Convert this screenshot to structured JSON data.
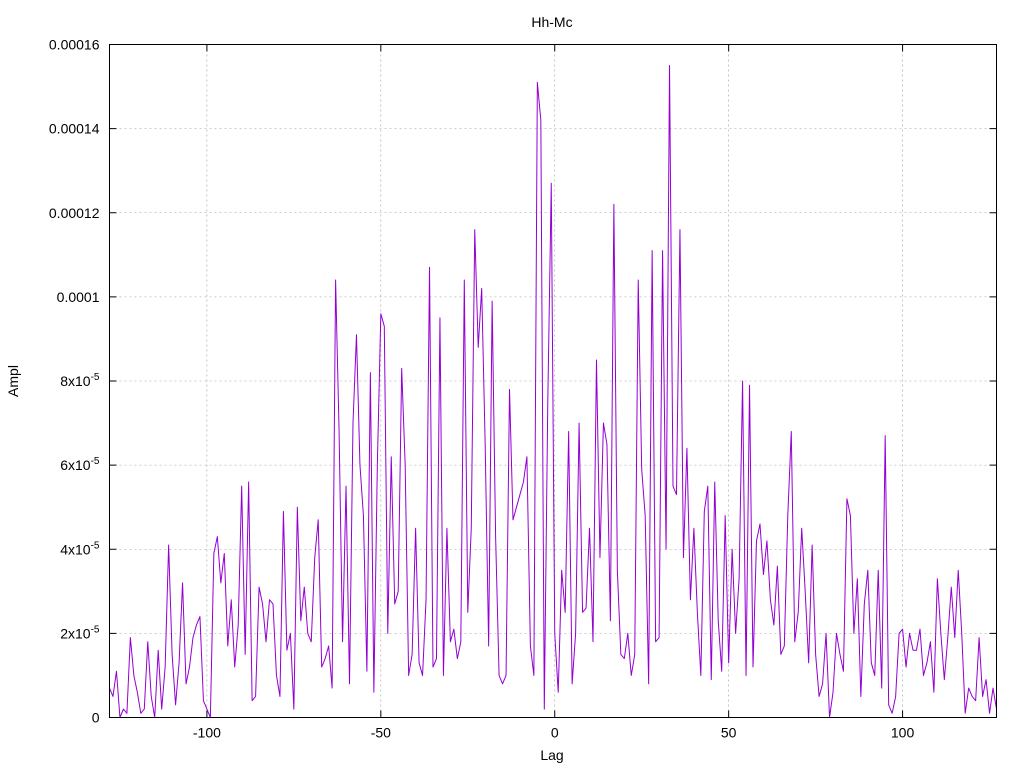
{
  "chart_data": {
    "type": "line",
    "title": "Hh-Mc",
    "xlabel": "Lag",
    "ylabel": "Ampl",
    "xlim": [
      -128,
      127
    ],
    "ylim": [
      0,
      0.00016
    ],
    "grid": true,
    "line_color": "#9400d3",
    "x_ticks": [
      {
        "value": -100,
        "label": "-100"
      },
      {
        "value": -50,
        "label": "-50"
      },
      {
        "value": 0,
        "label": "0"
      },
      {
        "value": 50,
        "label": "50"
      },
      {
        "value": 100,
        "label": "100"
      }
    ],
    "y_ticks": [
      {
        "value": 0,
        "label": "0",
        "mantissa": "0",
        "exponent": ""
      },
      {
        "value": 2e-05,
        "label": "2x10-5",
        "mantissa": "2x10",
        "exponent": "-5"
      },
      {
        "value": 4e-05,
        "label": "4x10-5",
        "mantissa": "4x10",
        "exponent": "-5"
      },
      {
        "value": 6e-05,
        "label": "6x10-5",
        "mantissa": "6x10",
        "exponent": "-5"
      },
      {
        "value": 8e-05,
        "label": "8x10-5",
        "mantissa": "8x10",
        "exponent": "-5"
      },
      {
        "value": 0.0001,
        "label": "0.0001",
        "mantissa": "0.0001",
        "exponent": ""
      },
      {
        "value": 0.00012,
        "label": "0.00012",
        "mantissa": "0.00012",
        "exponent": ""
      },
      {
        "value": 0.00014,
        "label": "0.00014",
        "mantissa": "0.00014",
        "exponent": ""
      },
      {
        "value": 0.00016,
        "label": "0.00016",
        "mantissa": "0.00016",
        "exponent": ""
      }
    ],
    "series": [
      {
        "x_start": -128,
        "x_step": 1,
        "values": [
          7e-06,
          5e-06,
          1.1e-05,
          0.0,
          2e-06,
          1e-06,
          1.9e-05,
          1e-05,
          6e-06,
          1e-06,
          2e-06,
          1.8e-05,
          5e-06,
          0.0,
          1.6e-05,
          2e-06,
          1.2e-05,
          4.1e-05,
          1.5e-05,
          3e-06,
          1.3e-05,
          3.2e-05,
          8e-06,
          1.2e-05,
          1.9e-05,
          2.2e-05,
          2.4e-05,
          4e-06,
          2e-06,
          0.0,
          3.9e-05,
          4.3e-05,
          3.2e-05,
          3.9e-05,
          1.7e-05,
          2.8e-05,
          1.2e-05,
          2.2e-05,
          5.5e-05,
          1.5e-05,
          5.6e-05,
          4e-06,
          5e-06,
          3.1e-05,
          2.7e-05,
          1.8e-05,
          2.8e-05,
          2.7e-05,
          1e-05,
          5e-06,
          4.9e-05,
          1.6e-05,
          2e-05,
          2e-06,
          5e-05,
          2.3e-05,
          3.1e-05,
          2e-05,
          1.8e-05,
          3.8e-05,
          4.7e-05,
          1.2e-05,
          1.4e-05,
          1.7e-05,
          7e-06,
          0.000104,
          6.8e-05,
          1.8e-05,
          5.5e-05,
          8e-06,
          7e-05,
          9.1e-05,
          6e-05,
          4.8e-05,
          1.1e-05,
          8.2e-05,
          6e-06,
          6e-05,
          9.6e-05,
          9.3e-05,
          2e-05,
          6.2e-05,
          2.7e-05,
          3e-05,
          8.3e-05,
          6e-05,
          1e-05,
          1.5e-05,
          4.5e-05,
          1.3e-05,
          1e-05,
          2.8e-05,
          0.000107,
          1.2e-05,
          1.4e-05,
          9.5e-05,
          1e-05,
          4.5e-05,
          1.8e-05,
          2.1e-05,
          1.4e-05,
          1.8e-05,
          0.000104,
          2.5e-05,
          4.5e-05,
          0.000116,
          8.8e-05,
          0.000102,
          6.5e-05,
          1.7e-05,
          9.9e-05,
          4.3e-05,
          1e-05,
          8e-06,
          1e-05,
          7.8e-05,
          4.7e-05,
          5e-05,
          5.3e-05,
          5.6e-05,
          6.2e-05,
          1.7e-05,
          1e-05,
          0.000151,
          0.000142,
          2e-06,
          7.5e-05,
          0.000127,
          2e-05,
          6e-06,
          3.5e-05,
          2.5e-05,
          6.8e-05,
          8e-06,
          2e-05,
          7e-05,
          2.5e-05,
          2.6e-05,
          4.5e-05,
          1.8e-05,
          8.5e-05,
          3.8e-05,
          7e-05,
          6.5e-05,
          2.3e-05,
          0.000122,
          3.5e-05,
          1.5e-05,
          1.4e-05,
          2e-05,
          1e-05,
          1.5e-05,
          0.000104,
          5.9e-05,
          4.8e-05,
          8e-06,
          0.000111,
          1.8e-05,
          1.9e-05,
          0.000111,
          4e-05,
          0.000155,
          5.5e-05,
          5.3e-05,
          0.000116,
          3.8e-05,
          6.4e-05,
          2.8e-05,
          4.5e-05,
          2.5e-05,
          1e-05,
          4.9e-05,
          5.5e-05,
          9e-06,
          5.6e-05,
          2.3e-05,
          1.1e-05,
          4.8e-05,
          1.3e-05,
          4e-05,
          2e-05,
          3.3e-05,
          8e-05,
          1e-05,
          7.9e-05,
          1.2e-05,
          4.2e-05,
          4.6e-05,
          3.4e-05,
          4.2e-05,
          2.8e-05,
          2.2e-05,
          3.6e-05,
          1.5e-05,
          1.7e-05,
          4.8e-05,
          6.8e-05,
          1.8e-05,
          2.5e-05,
          4.5e-05,
          3e-05,
          1.3e-05,
          4.1e-05,
          1.5e-05,
          5e-06,
          8e-06,
          2e-05,
          0.0,
          6e-06,
          2e-05,
          1.5e-05,
          1.1e-05,
          5.2e-05,
          4.8e-05,
          2e-05,
          3.3e-05,
          5e-06,
          2.7e-05,
          3.5e-05,
          1.3e-05,
          1e-05,
          3.5e-05,
          7e-06,
          6.7e-05,
          3e-06,
          1e-06,
          5e-06,
          2e-05,
          2.1e-05,
          1.2e-05,
          2e-05,
          1.6e-05,
          1.6e-05,
          2.1e-05,
          1e-05,
          1.3e-05,
          1.8e-05,
          6e-06,
          3.3e-05,
          2e-05,
          9e-06,
          1.9e-05,
          3.1e-05,
          1.9e-05,
          3.5e-05,
          2e-05,
          1e-06,
          7e-06,
          5e-06,
          4e-06,
          1.9e-05,
          5e-06,
          9e-06,
          1e-06,
          7e-06,
          2e-06
        ]
      }
    ]
  }
}
